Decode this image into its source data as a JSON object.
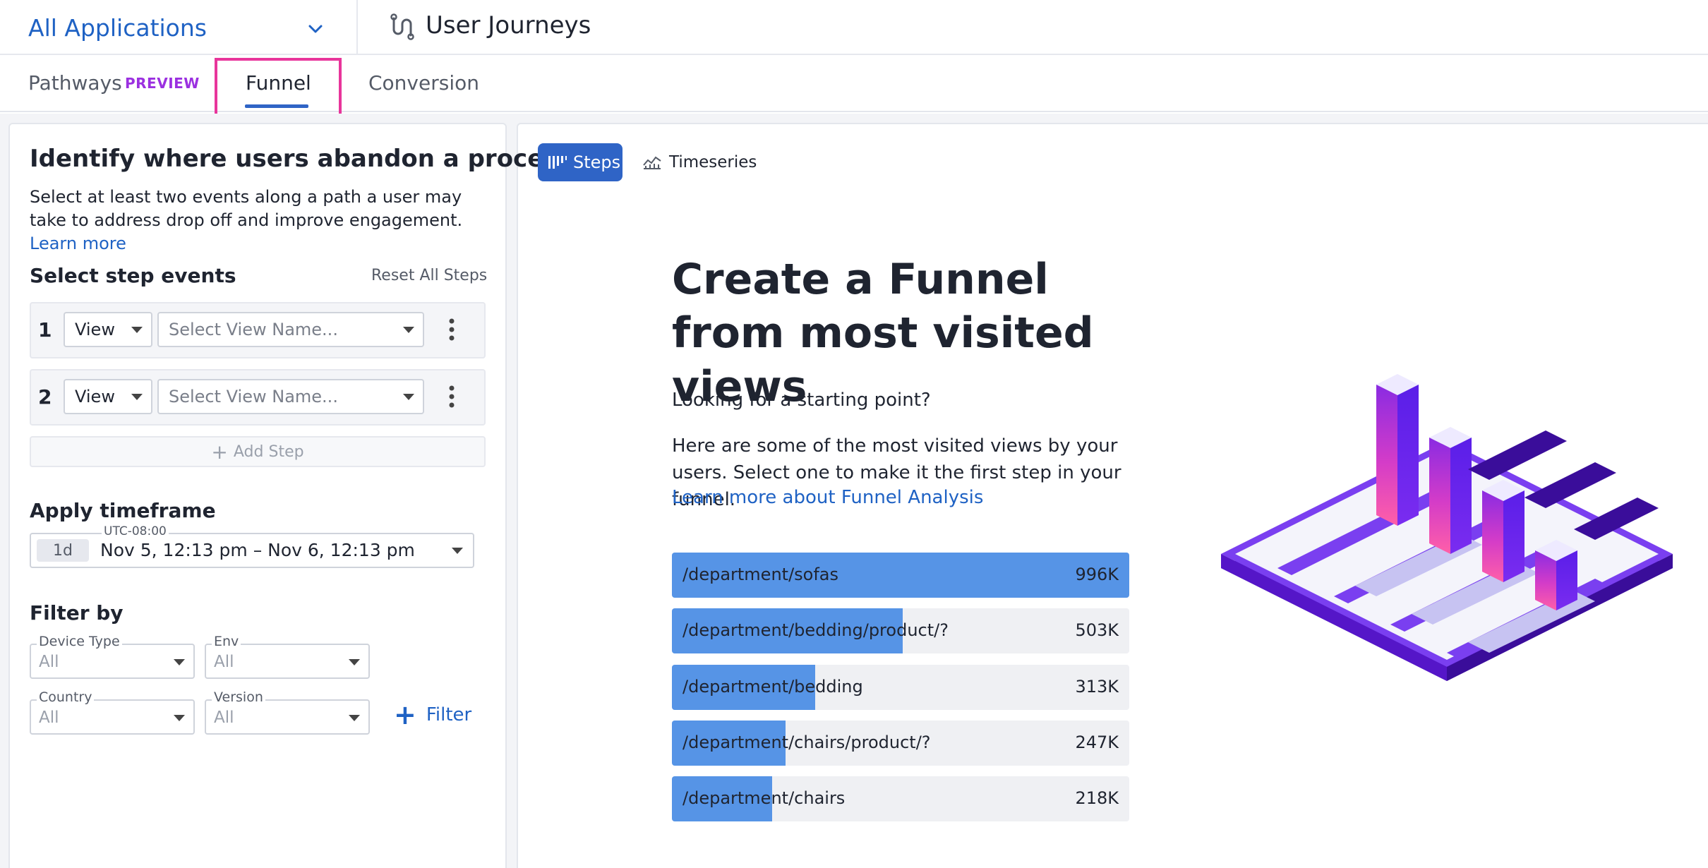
{
  "header": {
    "app_select": "All Applications",
    "title": "User Journeys"
  },
  "tabs": {
    "pathways": "Pathways",
    "preview_badge": "PREVIEW",
    "funnel": "Funnel",
    "conversion": "Conversion",
    "active": "Funnel"
  },
  "left_panel": {
    "heading": "Identify where users abandon a process",
    "description": "Select at least two events along a path a user may take to address drop off and improve engagement.",
    "learn_more": "Learn more",
    "steps_title": "Select step events",
    "reset_all": "Reset All Steps",
    "steps": [
      {
        "number": "1",
        "type": "View",
        "placeholder": "Select View Name..."
      },
      {
        "number": "2",
        "type": "View",
        "placeholder": "Select View Name..."
      }
    ],
    "add_step": "Add Step",
    "timeframe_title": "Apply timeframe",
    "timezone": "UTC-08:00",
    "timeframe_chip": "1d",
    "timeframe_range": "Nov 5, 12:13 pm – Nov 6, 12:13 pm",
    "filter_title": "Filter by",
    "filters": [
      {
        "label": "Device Type",
        "value": "All"
      },
      {
        "label": "Env",
        "value": "All"
      },
      {
        "label": "Country",
        "value": "All"
      },
      {
        "label": "Version",
        "value": "All"
      }
    ],
    "add_filter": "Filter"
  },
  "right_panel": {
    "view_toggle": {
      "steps": "Steps",
      "timeseries": "Timeseries",
      "active": "Steps"
    },
    "title": "Create a Funnel from most visited views",
    "subtitle": "Looking for a starting point?",
    "paragraph": "Here are some of the most visited views by your users. Select one to make it the first step in your funnel.",
    "link": "Learn more about Funnel Analysis",
    "top_views": [
      {
        "path": "/department/sofas",
        "count": "996K",
        "fraction": 1.0
      },
      {
        "path": "/department/bedding/product/?",
        "count": "503K",
        "fraction": 0.505
      },
      {
        "path": "/department/bedding",
        "count": "313K",
        "fraction": 0.314
      },
      {
        "path": "/department/chairs/product/?",
        "count": "247K",
        "fraction": 0.248
      },
      {
        "path": "/department/chairs",
        "count": "218K",
        "fraction": 0.219
      }
    ]
  },
  "colors": {
    "accent_blue": "#2f64c6",
    "link_blue": "#1f62c4",
    "bar_fill": "#5694e6",
    "highlight_pink": "#e8359b",
    "preview_purple": "#9b30e0"
  }
}
